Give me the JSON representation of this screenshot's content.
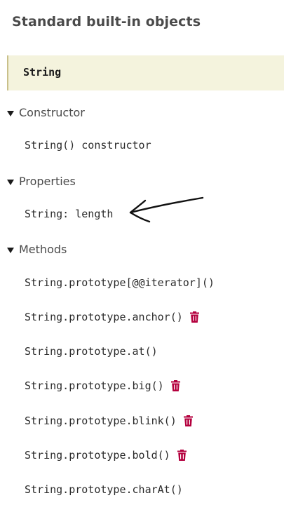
{
  "sidebar": {
    "heading": "Standard built-in objects",
    "current_item": "String",
    "sections": [
      {
        "label": "Constructor",
        "items": [
          {
            "label": "String() constructor",
            "deprecated": false
          }
        ]
      },
      {
        "label": "Properties",
        "items": [
          {
            "label": "String: length",
            "deprecated": false
          }
        ]
      },
      {
        "label": "Methods",
        "items": [
          {
            "label": "String.prototype[@@iterator]()",
            "deprecated": false
          },
          {
            "label": "String.prototype.anchor()",
            "deprecated": true
          },
          {
            "label": "String.prototype.at()",
            "deprecated": false
          },
          {
            "label": "String.prototype.big()",
            "deprecated": true
          },
          {
            "label": "String.prototype.blink()",
            "deprecated": true
          },
          {
            "label": "String.prototype.bold()",
            "deprecated": true
          },
          {
            "label": "String.prototype.charAt()",
            "deprecated": false
          }
        ]
      }
    ]
  },
  "icons": {
    "section_toggle": "triangle-down-icon",
    "deprecated": "trash-icon",
    "annotation": "hand-drawn-arrow-icon"
  },
  "colors": {
    "current_bg": "#f4f3dd",
    "current_border": "#c9c08a",
    "deprecated_icon": "#b4003e",
    "annotation": "#111111"
  }
}
